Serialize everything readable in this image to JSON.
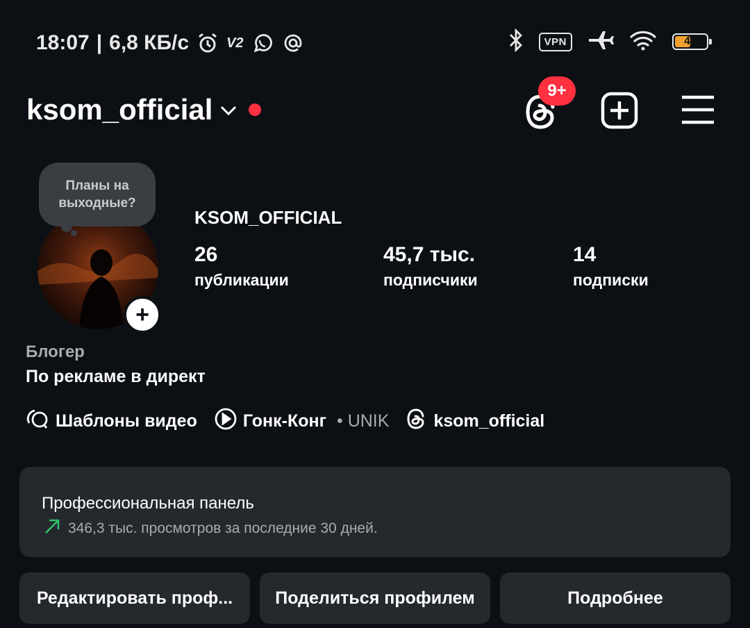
{
  "status_bar": {
    "time": "18:07",
    "separator": "|",
    "speed": "6,8 КБ/с",
    "v2": "V2",
    "vpn": "VPN",
    "battery": "49",
    "icons": [
      "alarm-icon",
      "v2-icon",
      "whatsapp-icon",
      "at-icon",
      "bluetooth-icon",
      "vpn-icon",
      "airplane-icon",
      "wifi-icon",
      "battery-icon"
    ]
  },
  "header": {
    "username": "ksom_official",
    "notification_badge": "9+"
  },
  "profile": {
    "note_bubble": "Планы на выходные?",
    "display_name": "KSOM_OFFICIAL",
    "stats": [
      {
        "value": "26",
        "label": "публикации"
      },
      {
        "value": "45,7 тыс.",
        "label": "подписчики"
      },
      {
        "value": "14",
        "label": "подписки"
      }
    ],
    "category": "Блогер",
    "bio": "По рекламе в директ",
    "links": [
      {
        "label": "Шаблоны видео"
      },
      {
        "label": "Гонк-Конг",
        "sep": " • ",
        "artist": "UNIK"
      },
      {
        "label": "ksom_official"
      }
    ]
  },
  "dashboard": {
    "title": "Профессиональная панель",
    "subtitle": "346,3 тыс. просмотров за последние 30 дней."
  },
  "buttons": {
    "edit": "Редактировать проф...",
    "share": "Поделиться профилем",
    "more": "Подробнее"
  },
  "colors": {
    "background": "#0c1014",
    "card": "#25292e",
    "accent_red": "#ff3040",
    "trend_green": "#2ec46d",
    "battery": "#f0a030"
  }
}
